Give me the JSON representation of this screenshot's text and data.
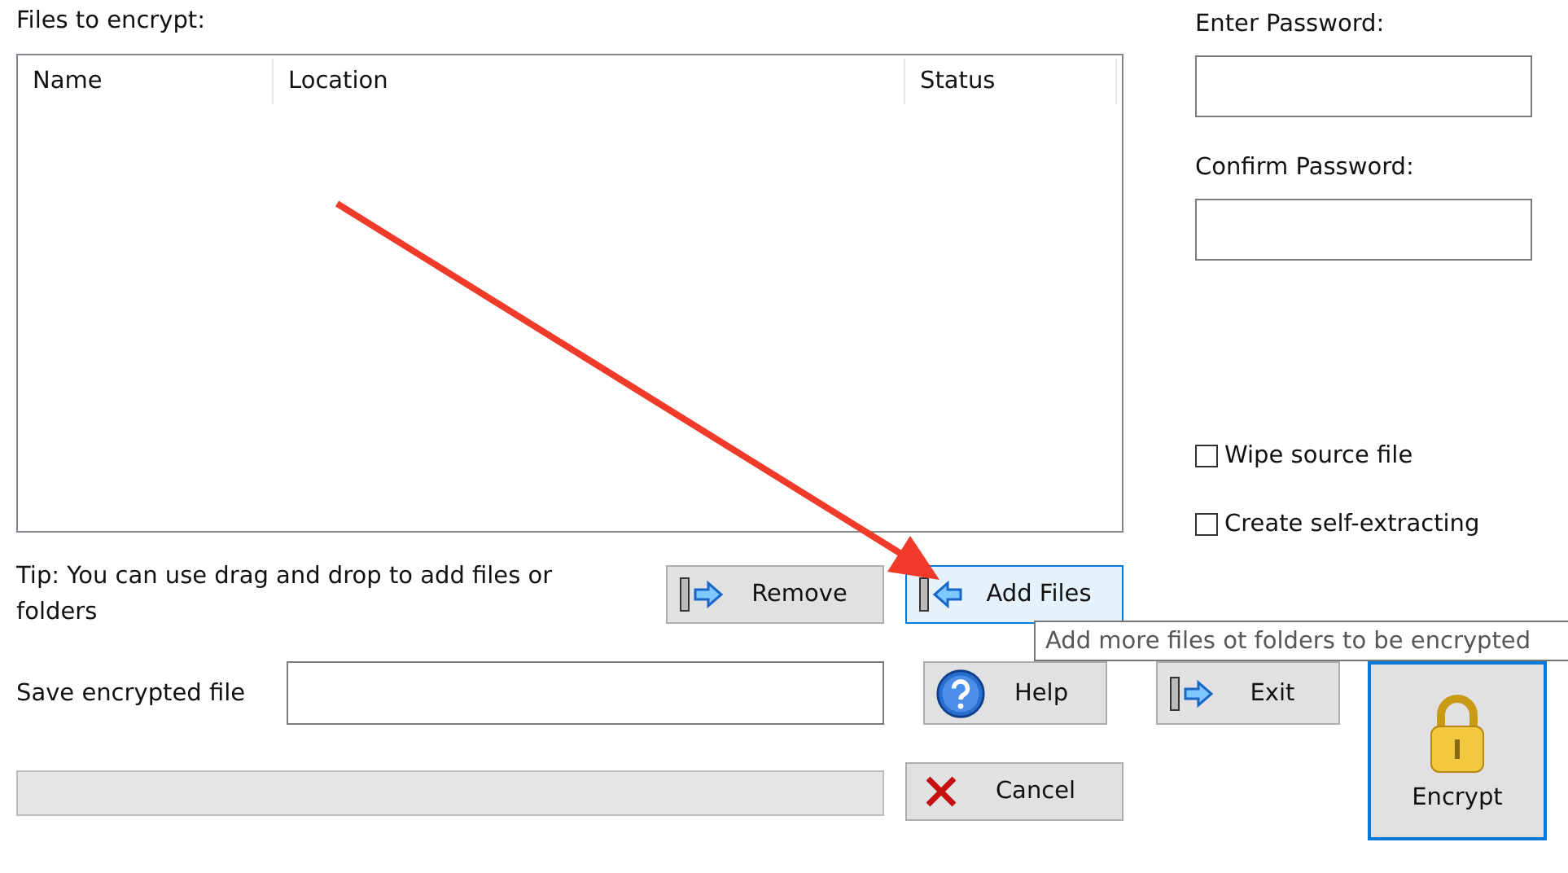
{
  "files_label": "Files to encrypt:",
  "file_list": {
    "columns": [
      "Name",
      "Location",
      "Status"
    ]
  },
  "password": {
    "label": "Enter Password:"
  },
  "confirm": {
    "label": "Confirm Password:"
  },
  "options": [
    {
      "label": "Wipe source file",
      "checked": false
    },
    {
      "label": "Create self-extracting",
      "checked": false
    }
  ],
  "tip": "Tip: You can use drag and drop to add files or folders",
  "buttons": [
    {
      "kind": "remove",
      "label": "Remove",
      "focused": false
    },
    {
      "kind": "add",
      "label": "Add Files",
      "focused": true
    },
    {
      "kind": "help",
      "label": "Help",
      "focused": false
    },
    {
      "kind": "exit",
      "label": "Exit",
      "focused": false
    },
    {
      "kind": "cancel",
      "label": "Cancel",
      "focused": false
    },
    {
      "kind": "encrypt",
      "label": "Encrypt",
      "focused": true
    }
  ],
  "save_label": "Save encrypted file",
  "tooltip": "Add more files ot folders to be encrypted"
}
